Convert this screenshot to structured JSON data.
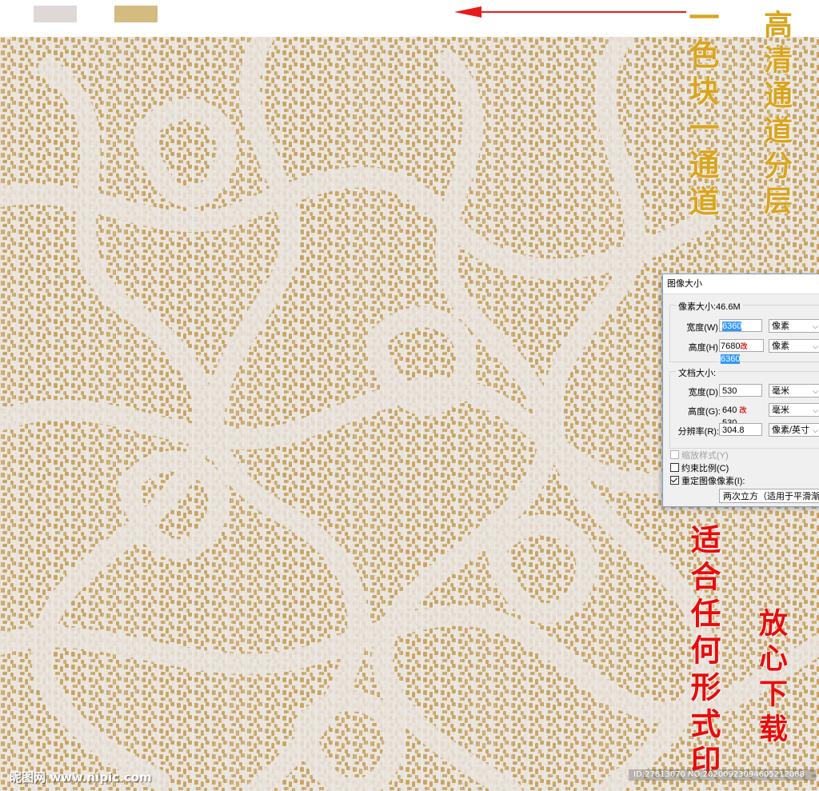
{
  "colors": {
    "swatch_1": "#e0d8d6",
    "swatch_2": "#d4bb80",
    "texture_base": "#e9e3dd",
    "texture_gold": "#c9a564",
    "gold_text": "#d9a520",
    "red_text": "#e80c0c",
    "arrow": "#e51b1b"
  },
  "callouts": {
    "one_swatch_one_channel": "一色块一通道",
    "hd_channel_layers": "高清通道分层",
    "any_print_form": "适合任何形式印",
    "download_worry_free": "放心下载"
  },
  "dialog": {
    "title": "图像大小",
    "pixel_size_label": "像素大小:46.6M",
    "width_label": "宽度(W):",
    "width_value": "6360",
    "width_unit": "像素",
    "height_label": "高度(H):",
    "height_value_old": "7680",
    "height_mark": "改",
    "height_value_new": "6360",
    "height_unit": "像素",
    "doc_size_label": "文档大小:",
    "doc_width_label": "宽度(D):",
    "doc_width_value": "530",
    "doc_width_unit": "毫米",
    "doc_height_label": "高度(G):",
    "doc_height_value_old": "640",
    "doc_height_mark": "改",
    "doc_height_value_new": "530",
    "doc_height_unit": "毫米",
    "resolution_label": "分辨率(R):",
    "resolution_value": "304.8",
    "resolution_unit": "像素/英寸",
    "scale_styles_label": "缩放样式(Y)",
    "constrain_label": "约束比例(C)",
    "resample_label": "重定图像像素(I):",
    "resample_method": "两次立方（适用于平滑渐变）"
  },
  "watermarks": {
    "left": "昵图网 www.nipic.com",
    "right": "ID:27813070 NO:20200923094605212088"
  }
}
